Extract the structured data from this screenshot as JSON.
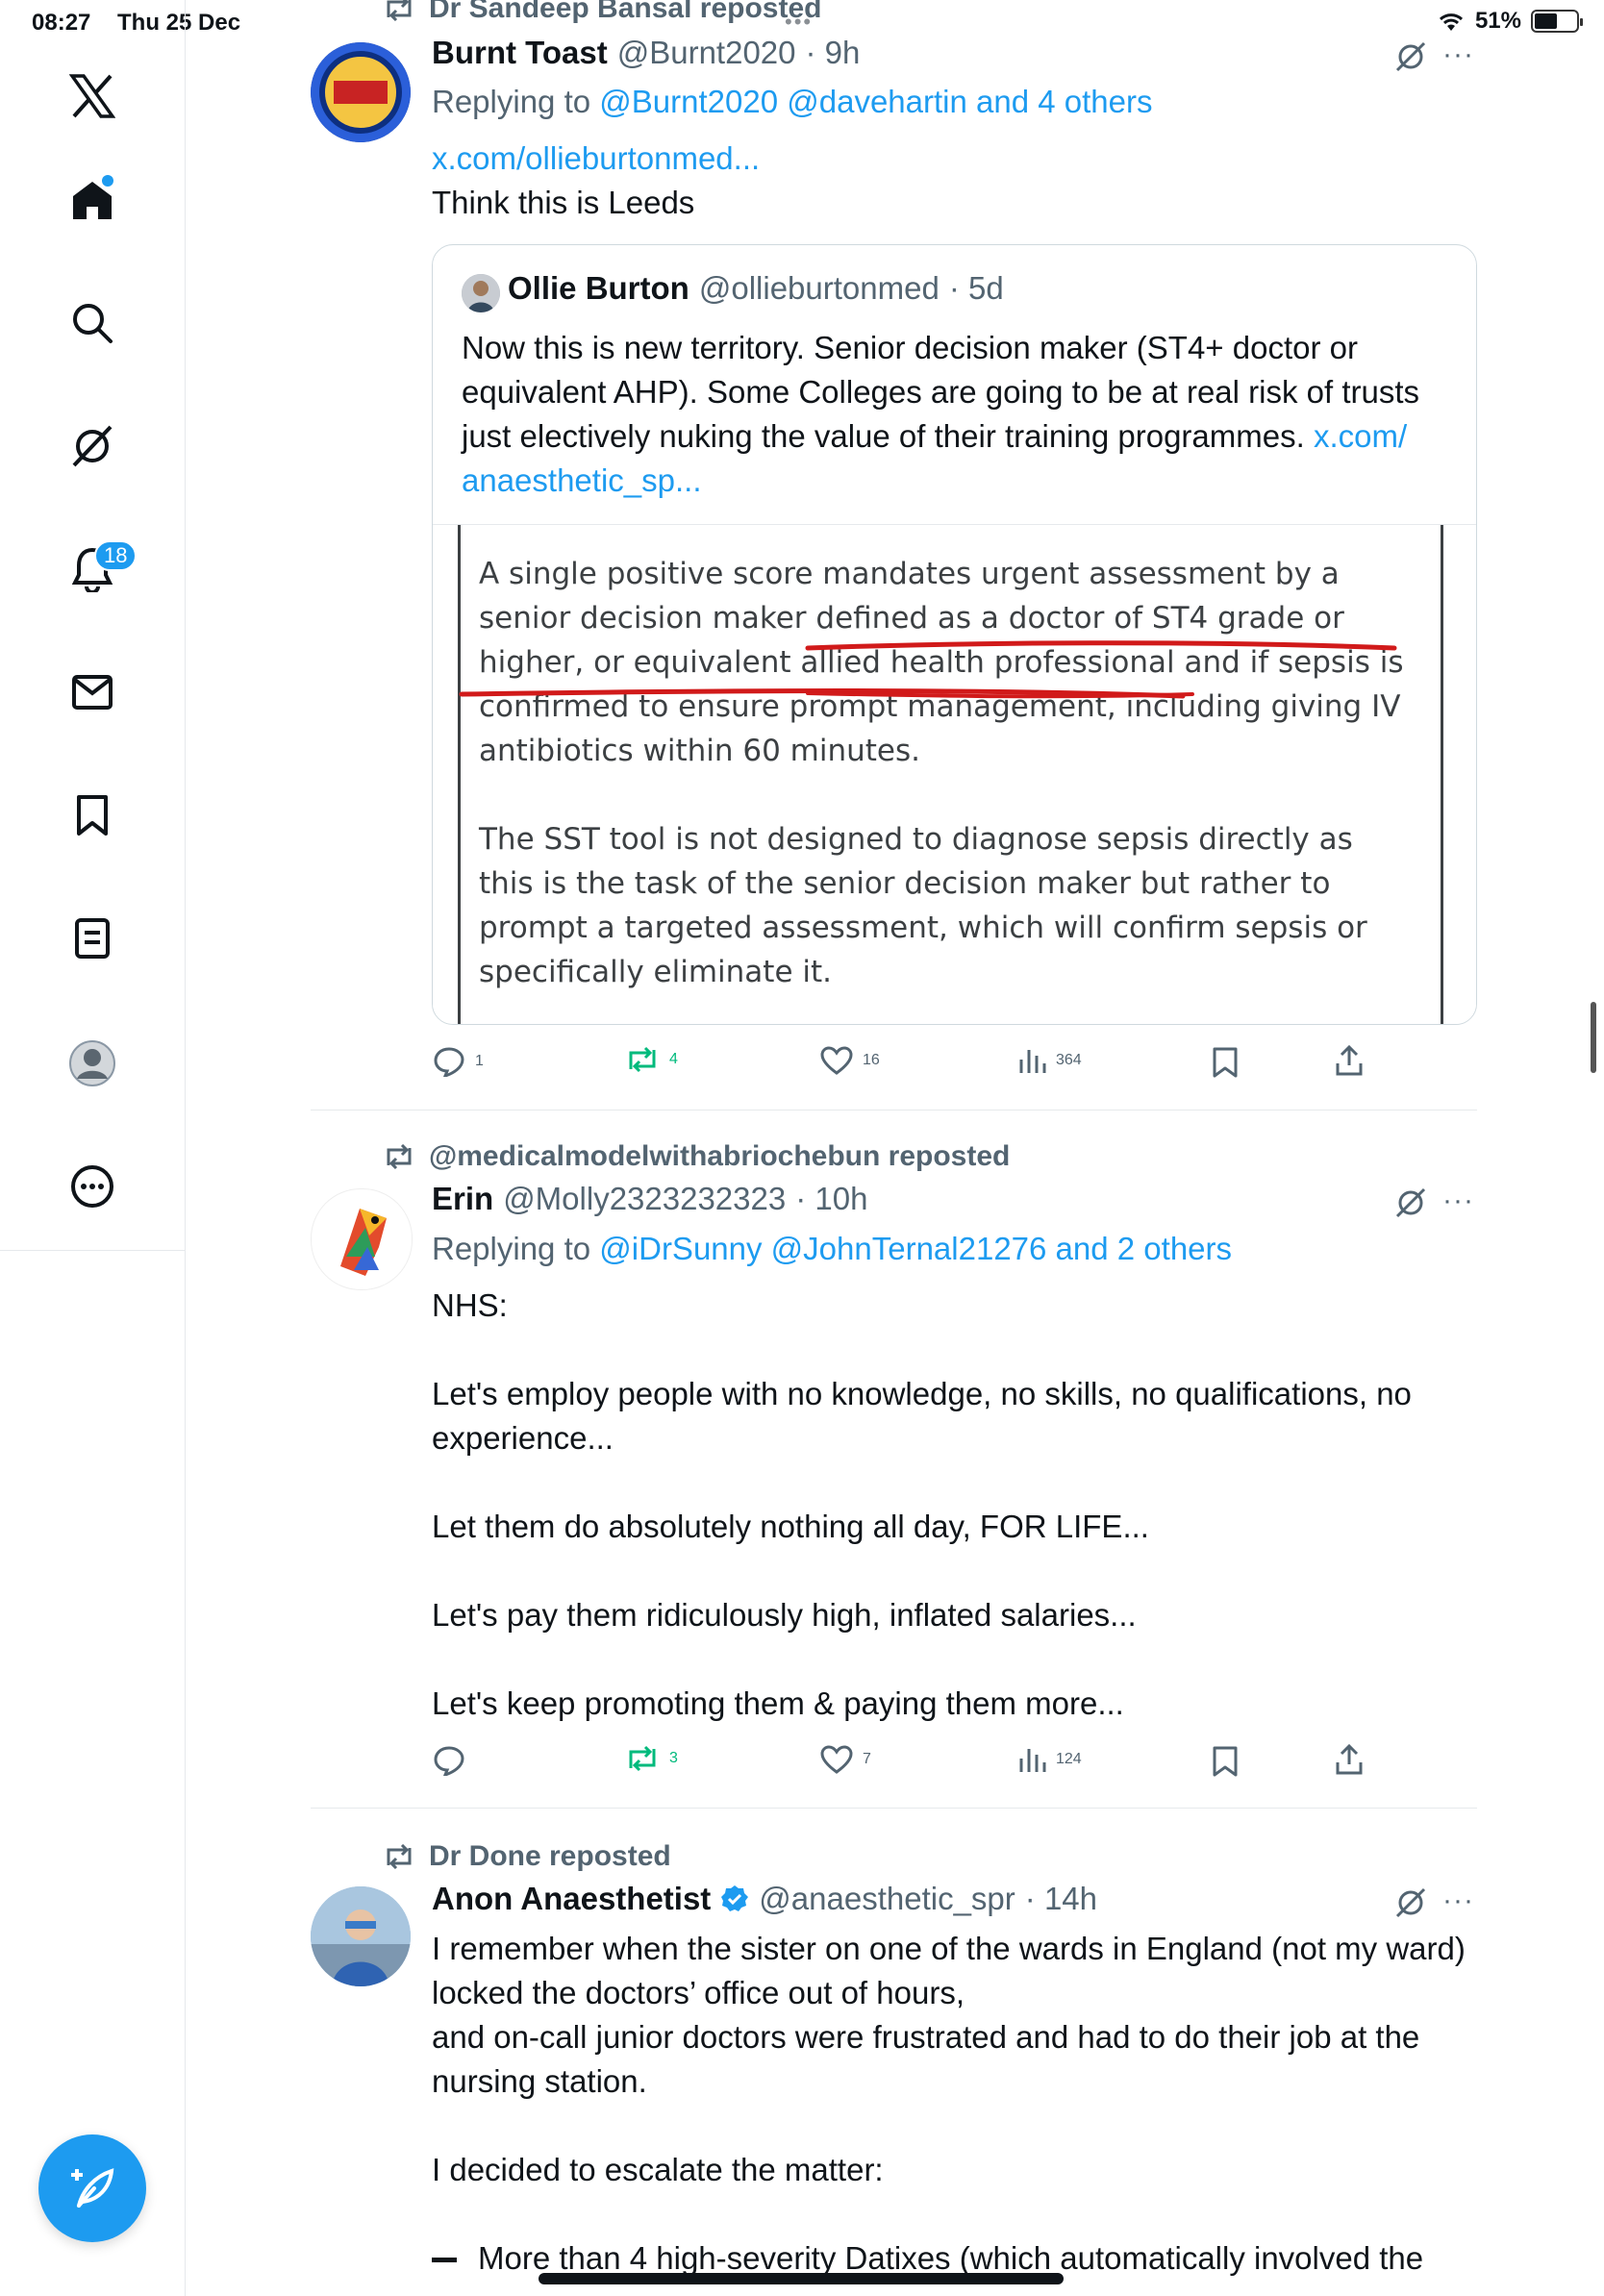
{
  "status_bar": {
    "time": "08:27",
    "date": "Thu 25 Dec",
    "battery": "51%",
    "battery_level": 0.51
  },
  "sidebar": {
    "icons": [
      "x-logo-icon",
      "home-icon",
      "search-icon",
      "grok-icon",
      "notifications-icon",
      "messages-icon",
      "bookmarks-icon",
      "lists-icon",
      "profile-icon",
      "more-icon"
    ],
    "notification_badge": "18"
  },
  "tweets": [
    {
      "repost_by": "Dr Sandeep Bansal reposted",
      "name": "Burnt Toast",
      "handle": "@Burnt2020",
      "time": "· 9h",
      "replying_prefix": "Replying to",
      "replying_to": "@Burnt2020 @davehartin and 4 others",
      "link": "x.com/ollieburtonmed...",
      "text": "Think this is Leeds",
      "quote": {
        "name": "Ollie Burton",
        "handle": "@ollieburtonmed",
        "time": "· 5d",
        "text": "Now this is new territory. Senior decision maker (ST4+ doctor or equivalent AHP). Some Colleges are going to be at real risk of trusts just electively nuking the value of their training programmes.",
        "link_part1": "x.com/",
        "link_part2": "anaesthetic_sp...",
        "image_lines": [
          "A single positive score mandates urgent assessment by a",
          "senior decision maker defined as a doctor of ST4 grade or",
          "higher, or equivalent allied health professional and if sepsis is",
          "confirmed to ensure prompt management, including giving IV",
          "antibiotics within 60 minutes.",
          "The SST tool is not designed to diagnose sepsis directly as",
          "this is the task of the senior decision maker but rather to",
          "prompt a targeted assessment, which will confirm sepsis or",
          "specifically eliminate it."
        ]
      },
      "stats": {
        "replies": "1",
        "reposts": "4",
        "likes": "16",
        "views": "364"
      }
    },
    {
      "repost_by": "@medicalmodelwithabriochebun reposted",
      "name": "Erin",
      "handle": "@Molly2323232323",
      "time": "· 10h",
      "replying_prefix": "Replying to",
      "replying_to": "@iDrSunny @JohnTernal21276 and 2 others",
      "paragraphs": [
        "NHS:",
        "Let's employ people with no knowledge, no skills, no qualifications, no experience...",
        "Let them do absolutely nothing all day, FOR LIFE...",
        "Let's pay them ridiculously high, inflated salaries...",
        "Let's keep promoting them & paying them more..."
      ],
      "stats": {
        "replies": "",
        "reposts": "3",
        "likes": "7",
        "views": "124"
      }
    },
    {
      "repost_by": "Dr Done reposted",
      "name": "Anon Anaesthetist",
      "handle": "@anaesthetic_spr",
      "time": "· 14h",
      "paragraphs": [
        "I remember when the sister on one of the wards in England (not my ward) locked the doctors’ office out of hours,",
        "and on-call junior doctors were frustrated and had to do their job at the nursing station.",
        "I decided to escalate the matter:",
        "More than 4 high-severity Datixes (which automatically involved the"
      ]
    }
  ]
}
